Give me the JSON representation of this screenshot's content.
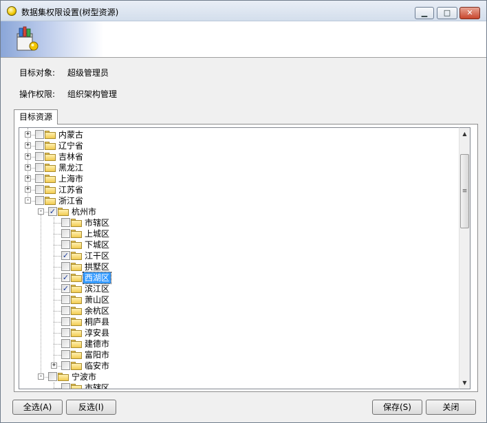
{
  "window": {
    "title": "数据集权限设置(树型资源)",
    "controls": {
      "minimize": "▁",
      "maximize": "□",
      "close": "✕"
    }
  },
  "fields": {
    "target_label": "目标对象:",
    "target_value": "超级管理员",
    "permission_label": "操作权限:",
    "permission_value": "组织架构管理"
  },
  "tab": {
    "label": "目标资源"
  },
  "tree": {
    "nodes": [
      {
        "label": "内蒙古",
        "level": 0,
        "expander": "+",
        "checked": false,
        "selected": false
      },
      {
        "label": "辽宁省",
        "level": 0,
        "expander": "+",
        "checked": false,
        "selected": false
      },
      {
        "label": "吉林省",
        "level": 0,
        "expander": "+",
        "checked": false,
        "selected": false
      },
      {
        "label": "黑龙江",
        "level": 0,
        "expander": "+",
        "checked": false,
        "selected": false
      },
      {
        "label": "上海市",
        "level": 0,
        "expander": "+",
        "checked": false,
        "selected": false
      },
      {
        "label": "江苏省",
        "level": 0,
        "expander": "+",
        "checked": false,
        "selected": false
      },
      {
        "label": "浙江省",
        "level": 0,
        "expander": "-",
        "checked": false,
        "selected": false
      },
      {
        "label": "杭州市",
        "level": 1,
        "expander": "-",
        "checked": true,
        "selected": false
      },
      {
        "label": "市辖区",
        "level": 2,
        "expander": "",
        "checked": false,
        "selected": false
      },
      {
        "label": "上城区",
        "level": 2,
        "expander": "",
        "checked": false,
        "selected": false
      },
      {
        "label": "下城区",
        "level": 2,
        "expander": "",
        "checked": false,
        "selected": false
      },
      {
        "label": "江干区",
        "level": 2,
        "expander": "",
        "checked": true,
        "selected": false
      },
      {
        "label": "拱墅区",
        "level": 2,
        "expander": "",
        "checked": false,
        "selected": false
      },
      {
        "label": "西湖区",
        "level": 2,
        "expander": "",
        "checked": true,
        "selected": true
      },
      {
        "label": "滨江区",
        "level": 2,
        "expander": "",
        "checked": true,
        "selected": false
      },
      {
        "label": "萧山区",
        "level": 2,
        "expander": "",
        "checked": false,
        "selected": false
      },
      {
        "label": "余杭区",
        "level": 2,
        "expander": "",
        "checked": false,
        "selected": false
      },
      {
        "label": "桐庐县",
        "level": 2,
        "expander": "",
        "checked": false,
        "selected": false
      },
      {
        "label": "淳安县",
        "level": 2,
        "expander": "",
        "checked": false,
        "selected": false
      },
      {
        "label": "建德市",
        "level": 2,
        "expander": "",
        "checked": false,
        "selected": false
      },
      {
        "label": "富阳市",
        "level": 2,
        "expander": "",
        "checked": false,
        "selected": false
      },
      {
        "label": "临安市",
        "level": 2,
        "expander": "+",
        "checked": false,
        "selected": false
      },
      {
        "label": "宁波市",
        "level": 1,
        "expander": "-",
        "checked": false,
        "selected": false
      },
      {
        "label": "市辖区",
        "level": 2,
        "expander": "",
        "checked": false,
        "selected": false
      }
    ],
    "check_glyph": "✓"
  },
  "scrollbar": {
    "up": "▲",
    "down": "▼",
    "grip": "≡"
  },
  "buttons": {
    "select_all": "全选(A)",
    "invert": "反选(I)",
    "save": "保存(S)",
    "close": "关闭"
  }
}
